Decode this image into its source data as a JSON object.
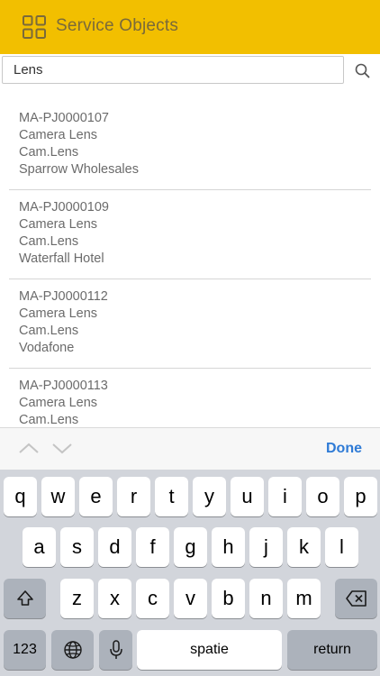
{
  "header": {
    "title": "Service Objects",
    "icon": "grid-icon",
    "background": "#f2bf00"
  },
  "search": {
    "value": "Lens",
    "icon": "search-icon"
  },
  "results": [
    {
      "id": "MA-PJ0000107",
      "name": "Camera Lens",
      "code": "Cam.Lens",
      "customer": "Sparrow Wholesales"
    },
    {
      "id": "MA-PJ0000109",
      "name": "Camera Lens",
      "code": "Cam.Lens",
      "customer": "Waterfall Hotel"
    },
    {
      "id": "MA-PJ0000112",
      "name": "Camera Lens",
      "code": "Cam.Lens",
      "customer": "Vodafone"
    },
    {
      "id": "MA-PJ0000113",
      "name": "Camera Lens",
      "code": "Cam.Lens",
      "customer": ""
    }
  ],
  "keyboard_toolbar": {
    "done_label": "Done",
    "done_color": "#2f7bd6"
  },
  "keyboard": {
    "row1": [
      "q",
      "w",
      "e",
      "r",
      "t",
      "y",
      "u",
      "i",
      "o",
      "p"
    ],
    "row2": [
      "a",
      "s",
      "d",
      "f",
      "g",
      "h",
      "j",
      "k",
      "l"
    ],
    "row3": [
      "z",
      "x",
      "c",
      "v",
      "b",
      "n",
      "m"
    ],
    "numbers_label": "123",
    "space_label": "spatie",
    "return_label": "return"
  }
}
